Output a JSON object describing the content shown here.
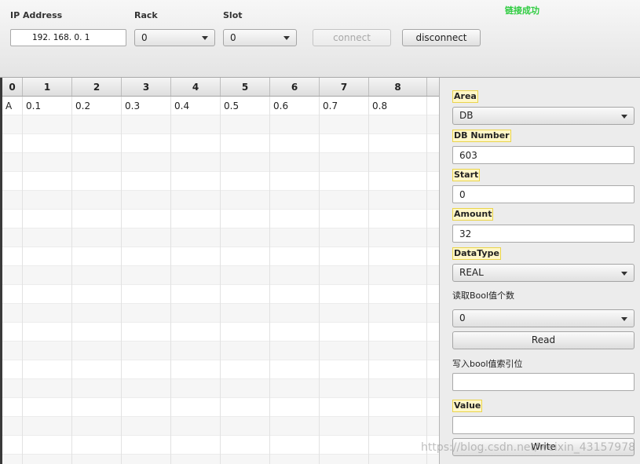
{
  "connection": {
    "ip_label": "IP Address",
    "ip_value": "192. 168. 0. 1",
    "rack_label": "Rack",
    "rack_value": "0",
    "slot_label": "Slot",
    "slot_value": "0",
    "connect_label": "connect",
    "disconnect_label": "disconnect",
    "status_text": "链接成功",
    "status_color": "#2ecc40"
  },
  "table": {
    "headers": [
      "0",
      "1",
      "2",
      "3",
      "4",
      "5",
      "6",
      "7",
      "8"
    ],
    "rows": [
      [
        "A",
        "0.1",
        "0.2",
        "0.3",
        "0.4",
        "0.5",
        "0.6",
        "0.7",
        "0.8"
      ]
    ]
  },
  "panel": {
    "area_label": "Area",
    "area_value": "DB",
    "db_number_label": "DB Number",
    "db_number_value": "603",
    "start_label": "Start",
    "start_value": "0",
    "amount_label": "Amount",
    "amount_value": "32",
    "datatype_label": "DataType",
    "datatype_value": "REAL",
    "bool_count_label": "读取Bool值个数",
    "bool_count_value": "0",
    "read_label": "Read",
    "bool_index_label": "写入bool值索引位",
    "bool_index_value": "",
    "value_label": "Value",
    "value_value": "",
    "write_label": "Write"
  },
  "watermark": "https://blog.csdn.net/weixin_43157978",
  "colors": {
    "label_highlight": "#fff7c9",
    "status_green": "#2ecc40"
  }
}
